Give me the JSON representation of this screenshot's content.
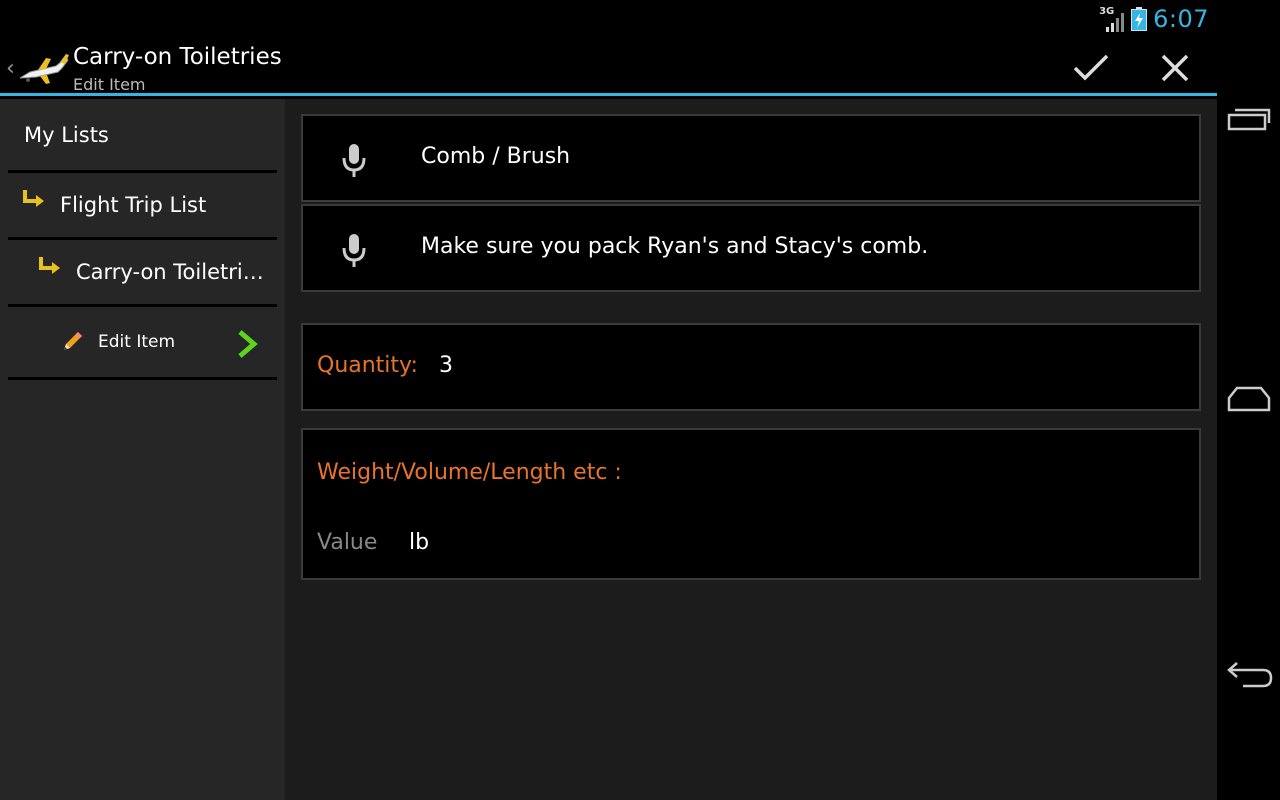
{
  "status_bar": {
    "network": "3G",
    "time": "6:07",
    "icons": [
      "signal-icon",
      "battery-charging-icon"
    ],
    "time_color": "#33b5e5"
  },
  "action_bar": {
    "title": "Carry-on Toiletries",
    "subtitle": "Edit Item",
    "icons": [
      "up-chevron-icon",
      "airplane-icon",
      "checkmark-icon",
      "close-icon"
    ],
    "accent_color": "#33b5e5"
  },
  "sidebar": {
    "crumbs": [
      {
        "label": "My Lists"
      },
      {
        "label": "Flight Trip List",
        "icon": "subdirectory-arrow-icon"
      },
      {
        "label": "Carry-on Toiletries",
        "icon": "subdirectory-arrow-icon"
      },
      {
        "label": "Edit Item",
        "icon": "pencil-icon",
        "trailing_icon": "chevron-right-icon"
      }
    ]
  },
  "form": {
    "name_value": "Comb / Brush",
    "note_value": "Make sure you pack Ryan's and Stacy's comb.",
    "quantity_label": "Quantity:",
    "quantity_value": "3",
    "measure_label": "Weight/Volume/Length etc :",
    "value_placeholder": "Value",
    "unit": "lb",
    "label_color": "#e8742a"
  },
  "nav_bar": {
    "icons": [
      "recent-apps-icon",
      "home-icon",
      "back-icon"
    ]
  }
}
